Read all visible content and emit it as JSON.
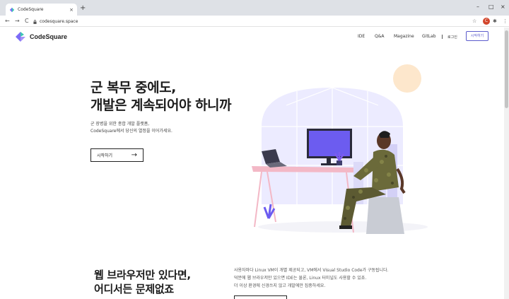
{
  "browser": {
    "tab_title": "CodeSquare",
    "tab_close": "×",
    "new_tab": "+",
    "url": "codesquare.space",
    "back": "←",
    "forward": "→",
    "reload": "C",
    "minimize": "–",
    "maximize": "□",
    "close": "×",
    "star": "☆",
    "extensions": "✱",
    "menu": "⋮",
    "profile_initial": "C",
    "colors": {
      "tabbar": "#dee1e6",
      "profile": "#d2462c"
    }
  },
  "header": {
    "logo_text": "CodeSquare",
    "nav": [
      {
        "label": "IDE"
      },
      {
        "label": "Q&A"
      },
      {
        "label": "Magazine"
      },
      {
        "label": "GitLab"
      }
    ],
    "login": "로그인",
    "signup": "시작하기",
    "colors": {
      "accent": "#5c5ccc"
    }
  },
  "hero": {
    "title_line1": "군 복무 중에도,",
    "title_line2": "개발은 계속되어야 하니까",
    "subtitle_line1": "군 장병을 위한 종합 개발 플랫폼,",
    "subtitle_line2": "CodeSquare에서 당신의 열정을 이어가세요.",
    "cta_label": "시작하기",
    "cta_icon": "→",
    "illustration": "developer-at-desk-illustration"
  },
  "feature": {
    "title_line1": "웹 브라우저만 있다면,",
    "title_line2": "어디서든 문제없죠",
    "desc_line1": "사용자마다 Linux VM이 개별 제공되고, VM에서 Visual Studio Code가 구동됩니다.",
    "desc_line2": "덕분에 웹 브라우저만 있으면 IDE는 물론, Linux 터미널도 사용할 수 있죠.",
    "desc_line3": "더 이상 환경에 신경쓰지 않고 개발에만 집중하세요."
  }
}
